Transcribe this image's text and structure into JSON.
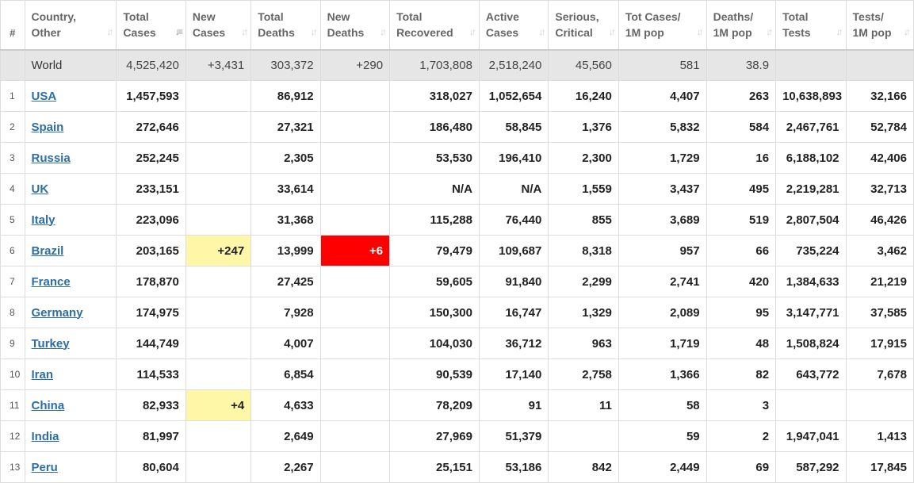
{
  "headers": [
    {
      "l1": "#",
      "l2": ""
    },
    {
      "l1": "Country,",
      "l2": "Other"
    },
    {
      "l1": "Total",
      "l2": "Cases"
    },
    {
      "l1": "New",
      "l2": "Cases"
    },
    {
      "l1": "Total",
      "l2": "Deaths"
    },
    {
      "l1": "New",
      "l2": "Deaths"
    },
    {
      "l1": "Total",
      "l2": "Recovered"
    },
    {
      "l1": "Active",
      "l2": "Cases"
    },
    {
      "l1": "Serious,",
      "l2": "Critical"
    },
    {
      "l1": "Tot Cases/",
      "l2": "1M pop"
    },
    {
      "l1": "Deaths/",
      "l2": "1M pop"
    },
    {
      "l1": "Total",
      "l2": "Tests"
    },
    {
      "l1": "Tests/",
      "l2": "1M pop"
    }
  ],
  "world": {
    "country": "World",
    "total_cases": "4,525,420",
    "new_cases": "+3,431",
    "total_deaths": "303,372",
    "new_deaths": "+290",
    "total_recovered": "1,703,808",
    "active_cases": "2,518,240",
    "serious": "45,560",
    "cases_per_m": "581",
    "deaths_per_m": "38.9",
    "total_tests": "",
    "tests_per_m": ""
  },
  "rows": [
    {
      "idx": "1",
      "country": "USA",
      "total_cases": "1,457,593",
      "new_cases": "",
      "total_deaths": "86,912",
      "new_deaths": "",
      "total_recovered": "318,027",
      "active_cases": "1,052,654",
      "serious": "16,240",
      "cases_per_m": "4,407",
      "deaths_per_m": "263",
      "total_tests": "10,638,893",
      "tests_per_m": "32,166"
    },
    {
      "idx": "2",
      "country": "Spain",
      "total_cases": "272,646",
      "new_cases": "",
      "total_deaths": "27,321",
      "new_deaths": "",
      "total_recovered": "186,480",
      "active_cases": "58,845",
      "serious": "1,376",
      "cases_per_m": "5,832",
      "deaths_per_m": "584",
      "total_tests": "2,467,761",
      "tests_per_m": "52,784"
    },
    {
      "idx": "3",
      "country": "Russia",
      "total_cases": "252,245",
      "new_cases": "",
      "total_deaths": "2,305",
      "new_deaths": "",
      "total_recovered": "53,530",
      "active_cases": "196,410",
      "serious": "2,300",
      "cases_per_m": "1,729",
      "deaths_per_m": "16",
      "total_tests": "6,188,102",
      "tests_per_m": "42,406"
    },
    {
      "idx": "4",
      "country": "UK",
      "total_cases": "233,151",
      "new_cases": "",
      "total_deaths": "33,614",
      "new_deaths": "",
      "total_recovered": "N/A",
      "active_cases": "N/A",
      "serious": "1,559",
      "cases_per_m": "3,437",
      "deaths_per_m": "495",
      "total_tests": "2,219,281",
      "tests_per_m": "32,713"
    },
    {
      "idx": "5",
      "country": "Italy",
      "total_cases": "223,096",
      "new_cases": "",
      "total_deaths": "31,368",
      "new_deaths": "",
      "total_recovered": "115,288",
      "active_cases": "76,440",
      "serious": "855",
      "cases_per_m": "3,689",
      "deaths_per_m": "519",
      "total_tests": "2,807,504",
      "tests_per_m": "46,426"
    },
    {
      "idx": "6",
      "country": "Brazil",
      "total_cases": "203,165",
      "new_cases": "+247",
      "total_deaths": "13,999",
      "new_deaths": "+6",
      "total_recovered": "79,479",
      "active_cases": "109,687",
      "serious": "8,318",
      "cases_per_m": "957",
      "deaths_per_m": "66",
      "total_tests": "735,224",
      "tests_per_m": "3,462"
    },
    {
      "idx": "7",
      "country": "France",
      "total_cases": "178,870",
      "new_cases": "",
      "total_deaths": "27,425",
      "new_deaths": "",
      "total_recovered": "59,605",
      "active_cases": "91,840",
      "serious": "2,299",
      "cases_per_m": "2,741",
      "deaths_per_m": "420",
      "total_tests": "1,384,633",
      "tests_per_m": "21,219"
    },
    {
      "idx": "8",
      "country": "Germany",
      "total_cases": "174,975",
      "new_cases": "",
      "total_deaths": "7,928",
      "new_deaths": "",
      "total_recovered": "150,300",
      "active_cases": "16,747",
      "serious": "1,329",
      "cases_per_m": "2,089",
      "deaths_per_m": "95",
      "total_tests": "3,147,771",
      "tests_per_m": "37,585"
    },
    {
      "idx": "9",
      "country": "Turkey",
      "total_cases": "144,749",
      "new_cases": "",
      "total_deaths": "4,007",
      "new_deaths": "",
      "total_recovered": "104,030",
      "active_cases": "36,712",
      "serious": "963",
      "cases_per_m": "1,719",
      "deaths_per_m": "48",
      "total_tests": "1,508,824",
      "tests_per_m": "17,915"
    },
    {
      "idx": "10",
      "country": "Iran",
      "total_cases": "114,533",
      "new_cases": "",
      "total_deaths": "6,854",
      "new_deaths": "",
      "total_recovered": "90,539",
      "active_cases": "17,140",
      "serious": "2,758",
      "cases_per_m": "1,366",
      "deaths_per_m": "82",
      "total_tests": "643,772",
      "tests_per_m": "7,678"
    },
    {
      "idx": "11",
      "country": "China",
      "total_cases": "82,933",
      "new_cases": "+4",
      "total_deaths": "4,633",
      "new_deaths": "",
      "total_recovered": "78,209",
      "active_cases": "91",
      "serious": "11",
      "cases_per_m": "58",
      "deaths_per_m": "3",
      "total_tests": "",
      "tests_per_m": ""
    },
    {
      "idx": "12",
      "country": "India",
      "total_cases": "81,997",
      "new_cases": "",
      "total_deaths": "2,649",
      "new_deaths": "",
      "total_recovered": "27,969",
      "active_cases": "51,379",
      "serious": "",
      "cases_per_m": "59",
      "deaths_per_m": "2",
      "total_tests": "1,947,041",
      "tests_per_m": "1,413"
    },
    {
      "idx": "13",
      "country": "Peru",
      "total_cases": "80,604",
      "new_cases": "",
      "total_deaths": "2,267",
      "new_deaths": "",
      "total_recovered": "25,151",
      "active_cases": "53,186",
      "serious": "842",
      "cases_per_m": "2,449",
      "deaths_per_m": "69",
      "total_tests": "587,292",
      "tests_per_m": "17,845"
    }
  ],
  "colors": {
    "new_cases_highlight": "#fff7a8",
    "new_deaths_highlight": "#ff0000",
    "link": "#2c6ea6",
    "world_row_bg": "#e6e6e6"
  },
  "icons": {
    "sort": "sort-arrows-icon",
    "sort_active": "sort-desc-icon"
  }
}
